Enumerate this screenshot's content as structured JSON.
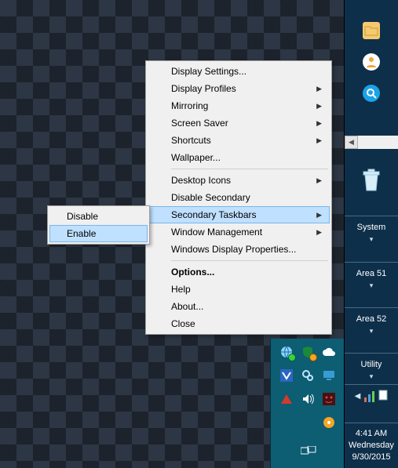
{
  "context_menu": {
    "items": [
      {
        "label": "Display Settings...",
        "submenu": false
      },
      {
        "label": "Display Profiles",
        "submenu": true
      },
      {
        "label": "Mirroring",
        "submenu": true
      },
      {
        "label": "Screen Saver",
        "submenu": true
      },
      {
        "label": "Shortcuts",
        "submenu": true
      },
      {
        "label": "Wallpaper...",
        "submenu": false
      }
    ],
    "items2": [
      {
        "label": "Desktop Icons",
        "submenu": true
      },
      {
        "label": "Disable Secondary",
        "submenu": false
      },
      {
        "label": "Secondary Taskbars",
        "submenu": true,
        "highlight": true
      },
      {
        "label": "Window Management",
        "submenu": true
      },
      {
        "label": "Windows Display Properties...",
        "submenu": false
      }
    ],
    "items3": [
      {
        "label": "Options...",
        "bold": true
      },
      {
        "label": "Help"
      },
      {
        "label": "About..."
      },
      {
        "label": "Close"
      }
    ]
  },
  "submenu": {
    "items": [
      {
        "label": "Disable"
      },
      {
        "label": "Enable",
        "highlight": true
      }
    ]
  },
  "sidebar": {
    "top_icons": [
      {
        "name": "folder-icon"
      },
      {
        "name": "users-icon"
      },
      {
        "name": "search-icon"
      }
    ],
    "sections": [
      {
        "label": "System"
      },
      {
        "label": "Area 51"
      },
      {
        "label": "Area 52"
      },
      {
        "label": "Utility"
      }
    ],
    "clock": {
      "time": "4:41 AM",
      "day": "Wednesday",
      "date": "9/30/2015"
    }
  },
  "tray": {
    "icons": [
      "globe-icon",
      "shield-icon",
      "cloud-icon",
      "v-icon",
      "gears-icon",
      "monitor-icon",
      "triangle-icon",
      "speaker-icon",
      "app-icon",
      "disc-icon"
    ],
    "bottom_icon": "monitors-icon"
  }
}
